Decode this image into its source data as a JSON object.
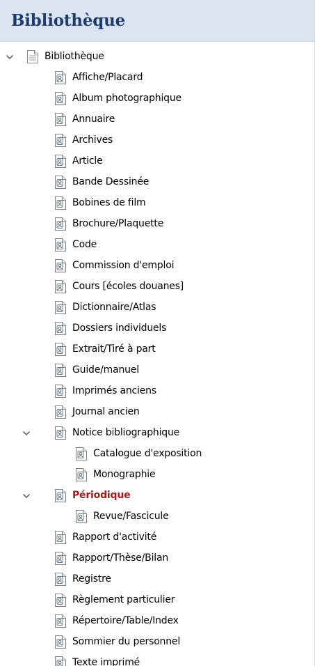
{
  "panel": {
    "title": "Bibliothèque"
  },
  "tree": {
    "root": {
      "label": "Bibliothèque",
      "expanded": true,
      "children": [
        {
          "label": "Affiche/Placard"
        },
        {
          "label": "Album photographique"
        },
        {
          "label": "Annuaire"
        },
        {
          "label": "Archives"
        },
        {
          "label": "Article"
        },
        {
          "label": "Bande Dessinée"
        },
        {
          "label": "Bobines de film"
        },
        {
          "label": "Brochure/Plaquette"
        },
        {
          "label": "Code"
        },
        {
          "label": "Commission d'emploi"
        },
        {
          "label": "Cours [écoles douanes]"
        },
        {
          "label": "Dictionnaire/Atlas"
        },
        {
          "label": "Dossiers individuels"
        },
        {
          "label": "Extrait/Tiré à part"
        },
        {
          "label": "Guide/manuel"
        },
        {
          "label": "Imprimés anciens"
        },
        {
          "label": "Journal ancien"
        },
        {
          "label": "Notice bibliographique",
          "expanded": true,
          "children": [
            {
              "label": "Catalogue d'exposition"
            },
            {
              "label": "Monographie"
            }
          ]
        },
        {
          "label": "Périodique",
          "expanded": true,
          "selected": true,
          "children": [
            {
              "label": "Revue/Fascicule"
            }
          ]
        },
        {
          "label": "Rapport d'activité"
        },
        {
          "label": "Rapport/Thèse/Bilan"
        },
        {
          "label": "Registre"
        },
        {
          "label": "Règlement particulier"
        },
        {
          "label": "Répertoire/Table/Index"
        },
        {
          "label": "Sommier du personnel"
        },
        {
          "label": "Texte imprimé"
        }
      ]
    }
  },
  "colors": {
    "header_background": "#dbe5f1",
    "header_text": "#1f3c6e",
    "selected_text": "#a31b1b"
  },
  "icons": {
    "root": "document-icon",
    "item": "record-type-icon",
    "expander": "chevron-down-icon"
  }
}
